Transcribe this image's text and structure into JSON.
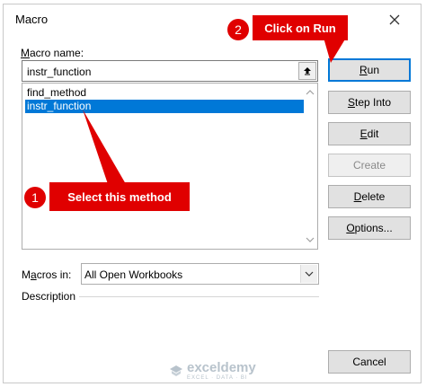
{
  "dialog": {
    "title": "Macro",
    "close_icon": "close-icon"
  },
  "macro_name": {
    "label_underlined": "M",
    "label_rest": "acro name:",
    "value": "instr_function"
  },
  "macro_list": [
    {
      "label": "find_method",
      "selected": false
    },
    {
      "label": "instr_function",
      "selected": true
    }
  ],
  "buttons": {
    "run": {
      "u": "R",
      "rest": "un"
    },
    "step_into": {
      "u": "S",
      "rest": "tep Into"
    },
    "edit": {
      "u": "E",
      "rest": "dit"
    },
    "create": {
      "u": "",
      "rest": "Create"
    },
    "delete": {
      "u": "D",
      "rest": "elete"
    },
    "options": {
      "u": "O",
      "rest": "ptions..."
    },
    "cancel": {
      "u": "",
      "rest": "Cancel"
    }
  },
  "macros_in": {
    "label_pre": "M",
    "label_underlined": "a",
    "label_rest": "cros in:",
    "value": "All Open Workbooks"
  },
  "description": {
    "label": "Description"
  },
  "watermark": {
    "brand": "exceldemy",
    "tagline": "EXCEL · DATA · BI"
  },
  "annotations": {
    "step1": {
      "number": "1",
      "text": "Select this method"
    },
    "step2": {
      "number": "2",
      "text": "Click on Run"
    }
  },
  "colors": {
    "callout": "#e00000",
    "selection": "#0078d7"
  }
}
